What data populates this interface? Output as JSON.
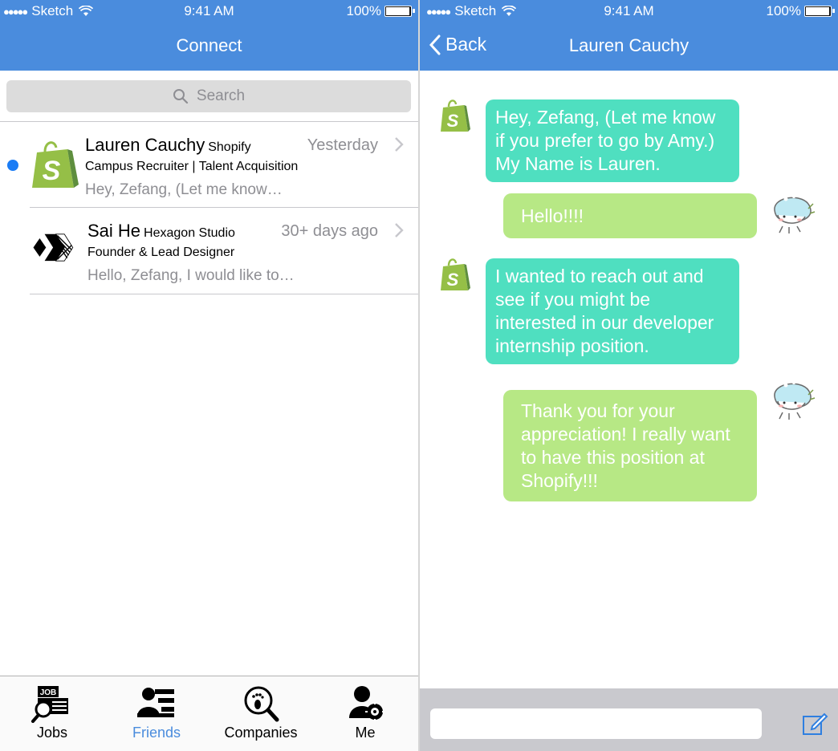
{
  "status": {
    "carrier": "Sketch",
    "time": "9:41 AM",
    "battery": "100%",
    "battery_level": 1.0
  },
  "colors": {
    "nav": "#4a8cdd",
    "incoming_bubble": "#4fdfc0",
    "outgoing_bubble": "#b7e885",
    "unread_dot": "#1a7cf5",
    "active_tab": "#4a8cdd"
  },
  "connect": {
    "title": "Connect",
    "search_placeholder": "Search",
    "conversations": [
      {
        "name": "Lauren Cauchy",
        "company": "Shopify",
        "time": "Yesterday",
        "role": "Campus Recruiter | Talent Acquisition",
        "preview": "Hey, Zefang, (Let me know…",
        "unread": true,
        "logo": "shopify-bag-icon"
      },
      {
        "name": "Sai He",
        "company": "Hexagon Studio",
        "time": "30+ days ago",
        "role": "Founder & Lead Designer",
        "preview": "Hello, Zefang, I would like to…",
        "unread": false,
        "logo": "hexagon-studio-logo"
      }
    ],
    "tabs": [
      {
        "label": "Jobs",
        "icon": "jobs-search-icon",
        "active": false
      },
      {
        "label": "Friends",
        "icon": "friends-list-icon",
        "active": true
      },
      {
        "label": "Companies",
        "icon": "companies-footprint-icon",
        "active": false
      },
      {
        "label": "Me",
        "icon": "me-settings-icon",
        "active": false
      }
    ]
  },
  "chat": {
    "back_label": "Back",
    "title": "Lauren Cauchy",
    "messages": [
      {
        "from": "them",
        "text": "Hey, Zefang, (Let me know if you prefer to go by Amy.) My Name is Lauren."
      },
      {
        "from": "me",
        "text": "Hello!!!!"
      },
      {
        "from": "them",
        "text": "I wanted to reach out and see if you might be interested in our developer internship position."
      },
      {
        "from": "me",
        "text": "Thank you for your appreciation! I really want to have this position at Shopify!!!"
      }
    ],
    "composer_value": ""
  }
}
